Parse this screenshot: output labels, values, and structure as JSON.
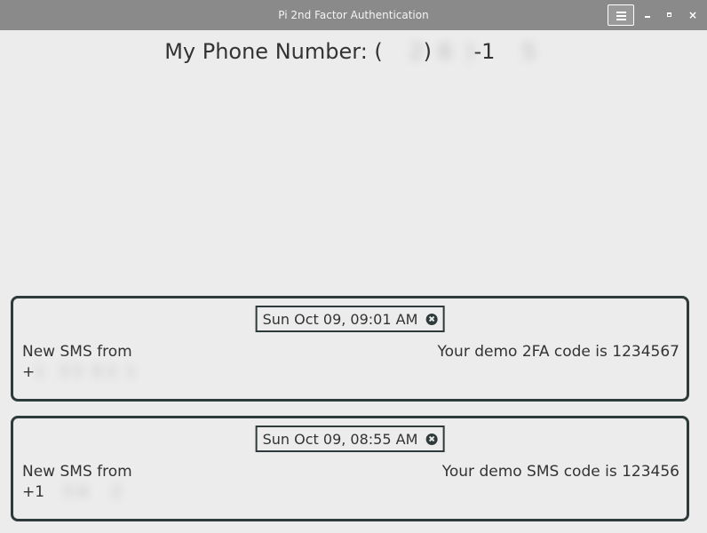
{
  "window": {
    "title": "Pi 2nd Factor Authentication",
    "menu_icon": "hamburger-menu-icon",
    "controls": {
      "minimize": "minimize-icon",
      "maximize": "maximize-icon",
      "close": "×"
    }
  },
  "phone": {
    "label": "My Phone Number: (",
    "area_code_redacted": "    2",
    "mid": ") ",
    "prefix_redacted": "6  )",
    "dash": "-1",
    "suffix_redacted": "    5 "
  },
  "messages": [
    {
      "timestamp": "Sun Oct 09, 09:01 AM",
      "from_label": "New SMS from",
      "from_prefix": "+",
      "from_redacted": "1   3 5  0 2  1",
      "body": "Your demo 2FA code is 1234567",
      "dismiss_icon": "close-circle-icon"
    },
    {
      "timestamp": "Sun Oct 09, 08:55 AM",
      "from_label": "New SMS from",
      "from_prefix": "+1",
      "from_redacted": "    5 6     2",
      "body": "Your demo SMS code is 123456",
      "dismiss_icon": "close-circle-icon"
    }
  ],
  "colors": {
    "titlebar": "#8a8a8a",
    "background": "#ececec",
    "card_border": "#2f3a3a",
    "text": "#333333"
  }
}
